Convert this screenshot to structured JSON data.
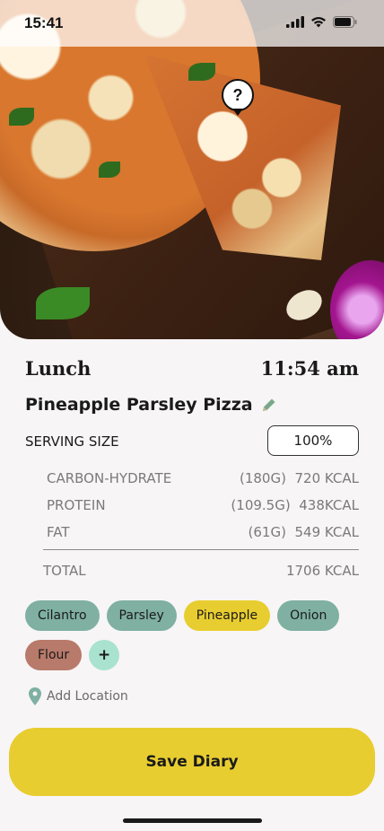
{
  "status_bar": {
    "time": "15:41"
  },
  "header": {
    "help_symbol": "?"
  },
  "meal": {
    "type": "Lunch",
    "time": "11:54 am"
  },
  "dish": {
    "name": "Pineapple Parsley Pizza",
    "edit_icon": "pencil-icon"
  },
  "serving": {
    "label": "SERVING SIZE",
    "value": "100%"
  },
  "nutrition": {
    "rows": [
      {
        "name": "CARBON-HYDRATE",
        "grams": "(180G)",
        "kcal": "720 KCAL"
      },
      {
        "name": "PROTEIN",
        "grams": "(109.5G)",
        "kcal": "438KCAL"
      },
      {
        "name": "FAT",
        "grams": "(61G)",
        "kcal": "549 KCAL"
      }
    ],
    "total_label": "TOTAL",
    "total_value": "1706 KCAL"
  },
  "tags": [
    {
      "label": "Cilantro",
      "color": "#7fb0a2"
    },
    {
      "label": "Parsley",
      "color": "#7fb0a2"
    },
    {
      "label": "Pineapple",
      "color": "#e8cd30"
    },
    {
      "label": "Onion",
      "color": "#7fb0a2"
    },
    {
      "label": "Flour",
      "color": "#b87a6a"
    }
  ],
  "add_tag_label": "+",
  "location": {
    "label": "Add Location",
    "icon": "map-pin-icon"
  },
  "save_button": {
    "label": "Save Diary"
  },
  "colors": {
    "accent": "#e8cd30",
    "tag_green": "#7fb0a2",
    "tag_brown": "#b87a6a",
    "add_mint": "#a9e2cf"
  }
}
